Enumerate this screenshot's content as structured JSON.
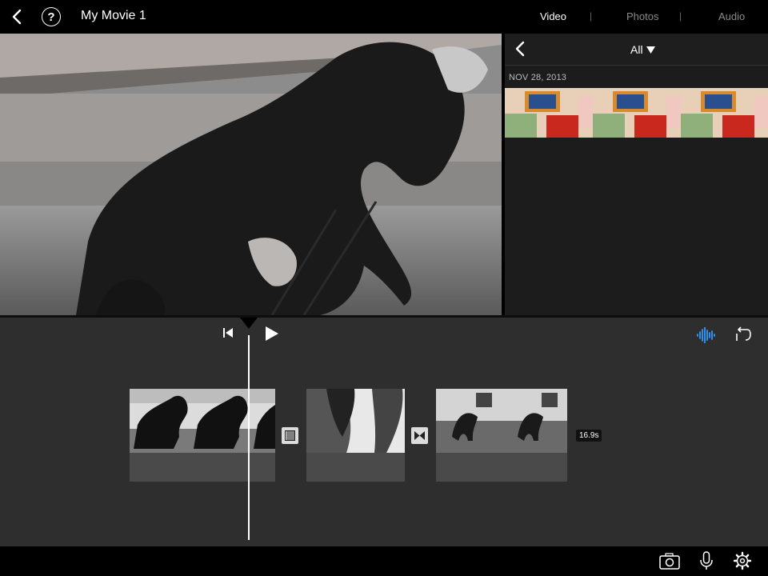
{
  "header": {
    "movie_title": "My Movie 1",
    "help_glyph": "?",
    "tabs": [
      {
        "label": "Video",
        "active": true
      },
      {
        "label": "Photos",
        "active": false
      },
      {
        "label": "Audio",
        "active": false
      }
    ],
    "tab_separator": "|"
  },
  "browser": {
    "filter_label": "All",
    "date_label": "NOV 28, 2013"
  },
  "timeline": {
    "duration_label": "16.9s"
  },
  "icons": {
    "back": "chevron-left-icon",
    "help": "question-circle-icon",
    "skip_start": "skip-to-start-icon",
    "play": "play-icon",
    "audio": "audio-waveform-icon",
    "undo": "undo-icon",
    "camera": "camera-icon",
    "mic": "microphone-icon",
    "settings": "gear-icon"
  },
  "colors": {
    "accent_blue": "#2f9bff",
    "timeline_bg": "#2e2e2e",
    "browser_bg": "#1c1c1c"
  }
}
